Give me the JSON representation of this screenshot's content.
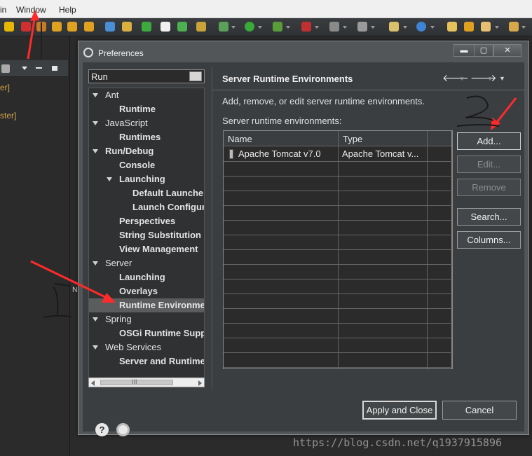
{
  "background": {
    "menu": [
      "in",
      "Window",
      "Help"
    ],
    "left_fragments": [
      "er]",
      "ster]"
    ],
    "strip_letter": "N"
  },
  "dialog": {
    "title": "Preferences",
    "window_buttons": {
      "minimize": "▬",
      "maximize": "▢",
      "close": "✕"
    },
    "filter_value": "Run",
    "tree": [
      {
        "label": "Ant",
        "level": 0,
        "expanded": true,
        "bold": false
      },
      {
        "label": "Runtime",
        "level": 1,
        "bold": true
      },
      {
        "label": "JavaScript",
        "level": 0,
        "expanded": true,
        "bold": false
      },
      {
        "label": "Runtimes",
        "level": 1,
        "bold": true
      },
      {
        "label": "Run/Debug",
        "level": 0,
        "expanded": true,
        "bold": true
      },
      {
        "label": "Console",
        "level": 1,
        "bold": true
      },
      {
        "label": "Launching",
        "level": 1,
        "expanded": true,
        "bold": true
      },
      {
        "label": "Default Launchers",
        "level": 2,
        "bold": true
      },
      {
        "label": "Launch Configurations",
        "level": 2,
        "bold": true
      },
      {
        "label": "Perspectives",
        "level": 1,
        "bold": true
      },
      {
        "label": "String Substitution",
        "level": 1,
        "bold": true
      },
      {
        "label": "View Management",
        "level": 1,
        "bold": true
      },
      {
        "label": "Server",
        "level": 0,
        "expanded": true,
        "bold": false
      },
      {
        "label": "Launching",
        "level": 1,
        "bold": true
      },
      {
        "label": "Overlays",
        "level": 1,
        "bold": true
      },
      {
        "label": "Runtime Environments",
        "level": 1,
        "bold": true,
        "selected": true
      },
      {
        "label": "Spring",
        "level": 0,
        "expanded": true,
        "bold": false
      },
      {
        "label": "OSGi Runtime Support",
        "level": 1,
        "bold": true
      },
      {
        "label": "Web Services",
        "level": 0,
        "expanded": true,
        "bold": false
      },
      {
        "label": "Server and Runtime",
        "level": 1,
        "bold": true
      }
    ],
    "scroll_label": "III",
    "page": {
      "title": "Server Runtime Environments",
      "description": "Add, remove, or edit server runtime environments.",
      "list_label": "Server runtime environments:",
      "columns": [
        "Name",
        "Type"
      ],
      "rows": [
        {
          "name": "Apache Tomcat v7.0",
          "type": "Apache Tomcat v..."
        }
      ],
      "buttons": {
        "add": "Add...",
        "edit": "Edit...",
        "remove": "Remove",
        "search": "Search...",
        "columns": "Columns..."
      }
    },
    "footer": {
      "help": "?",
      "apply_close": "Apply and Close",
      "cancel": "Cancel"
    }
  },
  "annotations": {
    "arrow_color": "#ff2a2a",
    "numbers": [
      "1",
      "2"
    ]
  },
  "watermark": "https://blog.csdn.net/q1937915896"
}
